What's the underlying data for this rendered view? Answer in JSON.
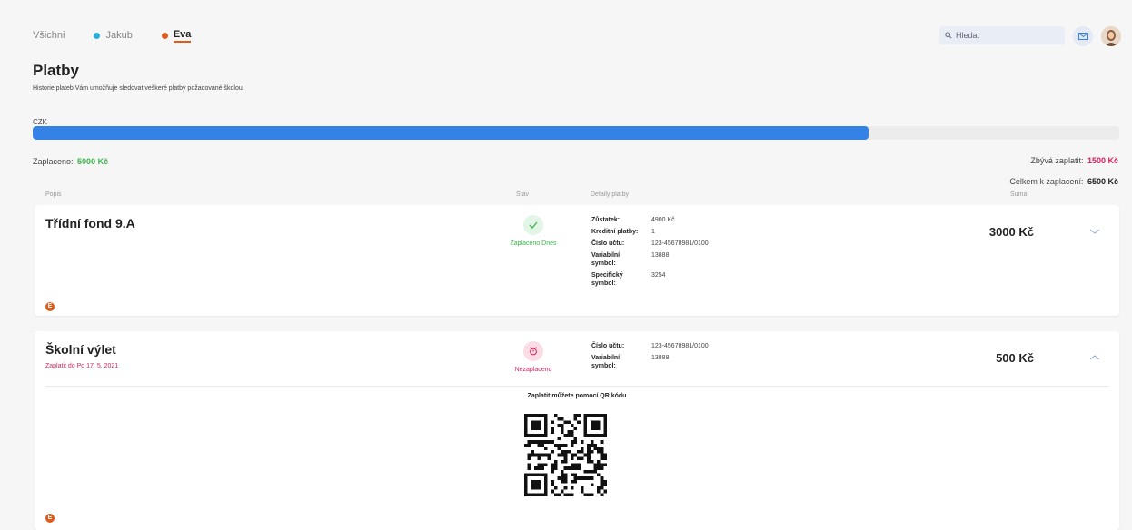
{
  "tabs": [
    {
      "label": "Všichni",
      "color": "",
      "active": false
    },
    {
      "label": "Jakub",
      "color": "#2ab0d8",
      "active": false
    },
    {
      "label": "Eva",
      "color": "#e05a1c",
      "active": true
    }
  ],
  "search": {
    "placeholder": "Hledat",
    "icon": "search-icon"
  },
  "header_icons": {
    "mail": "mail-icon",
    "avatar": "avatar"
  },
  "page": {
    "title": "Platby",
    "subtitle": "Historie plateb Vám umožňuje sledovat veškeré platby požadované školou."
  },
  "progress": {
    "currency": "CZK",
    "paid_fraction": 0.7692,
    "color": "#3482e6"
  },
  "summary": {
    "paid_label": "Zaplaceno:",
    "paid_value": "5000 Kč",
    "remaining_label": "Zbývá zaplatit:",
    "remaining_value": "1500 Kč",
    "total_label": "Celkem k zaplacení:",
    "total_value": "6500 Kč"
  },
  "columns": {
    "description": "Popis",
    "status": "Stav",
    "details": "Detaily platby",
    "sum": "Suma"
  },
  "payments": [
    {
      "title": "Třídní fond 9.A",
      "status": "Zaplaceno Dnes",
      "status_color": "#3bb54a",
      "status_icon": "check-icon",
      "details": [
        {
          "key": "Zůstatek:",
          "value": "4900 Kč"
        },
        {
          "key": "Kreditní platby:",
          "value": "1"
        },
        {
          "key": "Číslo účtu:",
          "value": "123-45678981/0100"
        },
        {
          "key": "Variabilní symbol:",
          "value": "13888"
        },
        {
          "key": "Specifický symbol:",
          "value": "3254"
        }
      ],
      "amount": "3000 Kč",
      "badge": "E",
      "chevron": "chevron-down-icon"
    },
    {
      "title": "Školní výlet",
      "due": "Zaplatit do Po 17. 5. 2021",
      "status": "Nezaplaceno",
      "status_color": "#d81e5b",
      "status_icon": "alarm-clock-icon",
      "details": [
        {
          "key": "Číslo účtu:",
          "value": "123-45678981/0100"
        },
        {
          "key": "Variabilní symbol:",
          "value": "13888"
        }
      ],
      "amount": "500 Kč",
      "qr_title": "Zaplatit můžete pomocí QR kódu",
      "badge": "E",
      "chevron": "chevron-up-icon"
    }
  ]
}
